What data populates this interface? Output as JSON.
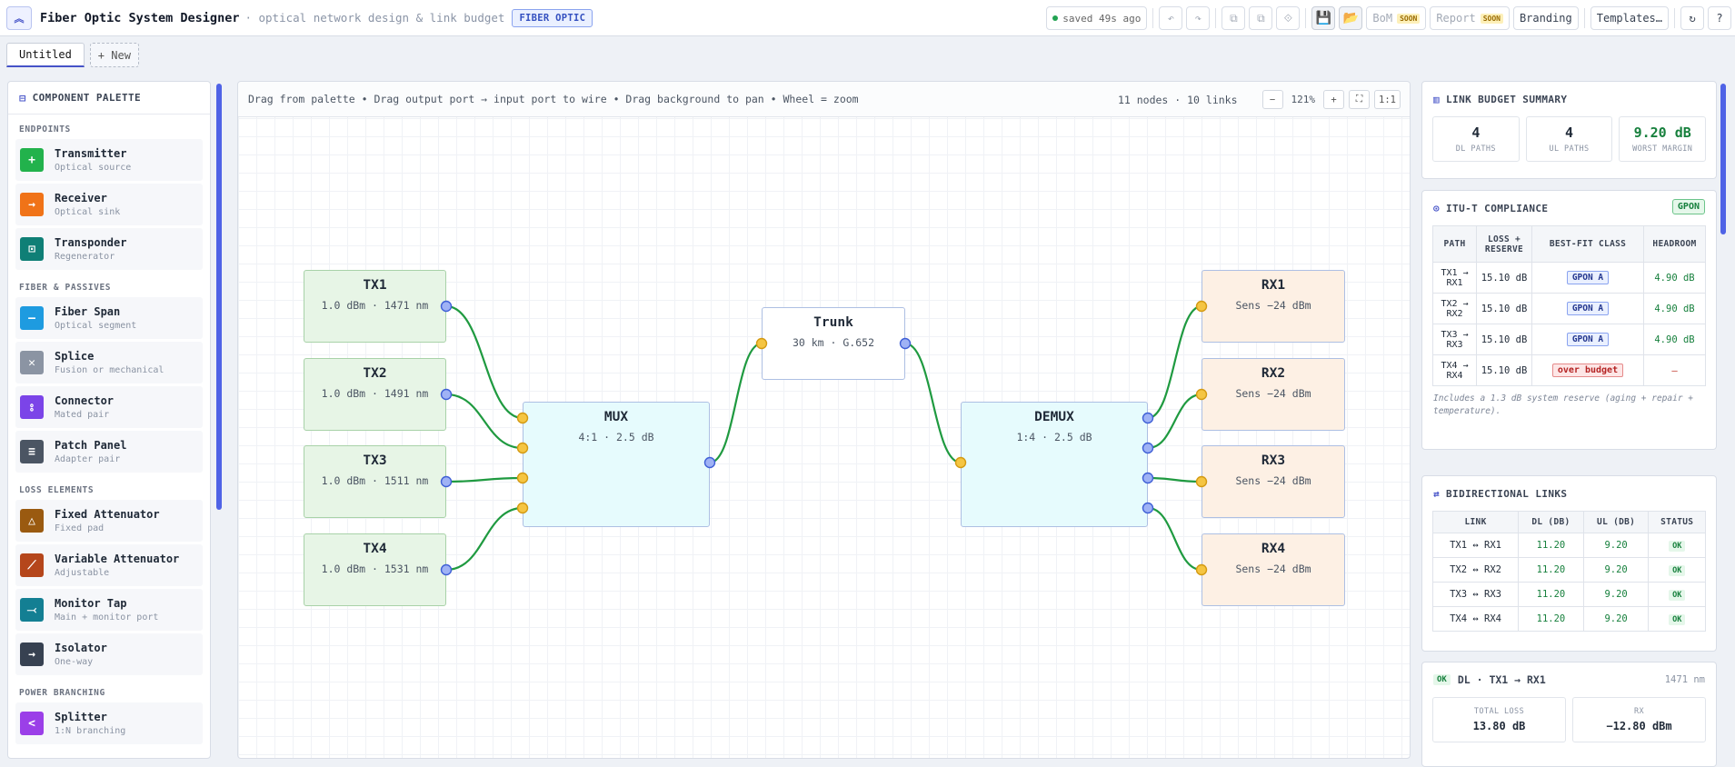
{
  "header": {
    "title": "Fiber Optic System Designer",
    "subtitle": "· optical network design & link budget",
    "badge": "FIBER OPTIC",
    "saved": "saved 49s ago",
    "buttons": {
      "undo": "↶",
      "redo": "↷",
      "copy": "⧉",
      "paste": "⧉",
      "delete": "⟐",
      "save": "💾",
      "open": "📂",
      "bom": "BoM",
      "bom_badge": "SOON",
      "report": "Report",
      "report_badge": "SOON",
      "branding": "Branding",
      "templates": "Templates…",
      "refresh": "↻",
      "help": "?"
    }
  },
  "tabs": [
    {
      "label": "Untitled",
      "active": true
    },
    {
      "label": "+ New",
      "active": false
    }
  ],
  "palette": {
    "title": "COMPONENT PALETTE",
    "sections": [
      {
        "label": "ENDPOINTS",
        "items": [
          {
            "name": "Transmitter",
            "desc": "Optical source",
            "icon": "plus-icon",
            "glyph": "+",
            "color": "#22b24c"
          },
          {
            "name": "Receiver",
            "desc": "Optical sink",
            "icon": "arrow-right-icon",
            "glyph": "→",
            "color": "#f07318"
          },
          {
            "name": "Transponder",
            "desc": "Regenerator",
            "icon": "transponder-icon",
            "glyph": "⊡",
            "color": "#0f7f76"
          }
        ]
      },
      {
        "label": "FIBER & PASSIVES",
        "items": [
          {
            "name": "Fiber Span",
            "desc": "Optical segment",
            "icon": "fiber-span-icon",
            "glyph": "—",
            "color": "#1e9be0"
          },
          {
            "name": "Splice",
            "desc": "Fusion or mechanical",
            "icon": "splice-icon",
            "glyph": "✕",
            "color": "#8b94a3"
          },
          {
            "name": "Connector",
            "desc": "Mated pair",
            "icon": "connector-icon",
            "glyph": "⦂",
            "color": "#7b44e8"
          },
          {
            "name": "Patch Panel",
            "desc": "Adapter pair",
            "icon": "patch-panel-icon",
            "glyph": "≡",
            "color": "#4b5563"
          }
        ]
      },
      {
        "label": "LOSS ELEMENTS",
        "items": [
          {
            "name": "Fixed Attenuator",
            "desc": "Fixed pad",
            "icon": "triangle-icon",
            "glyph": "△",
            "color": "#9a5a10"
          },
          {
            "name": "Variable Attenuator",
            "desc": "Adjustable",
            "icon": "variable-attenuator-icon",
            "glyph": "⟋",
            "color": "#b5461b"
          },
          {
            "name": "Monitor Tap",
            "desc": "Main + monitor port",
            "icon": "tap-icon",
            "glyph": "⤙",
            "color": "#137f93"
          },
          {
            "name": "Isolator",
            "desc": "One-way",
            "icon": "isolator-icon",
            "glyph": "→",
            "color": "#374151"
          }
        ]
      },
      {
        "label": "POWER BRANCHING",
        "items": [
          {
            "name": "Splitter",
            "desc": "1:N branching",
            "icon": "splitter-icon",
            "glyph": "<",
            "color": "#9b3fe8"
          }
        ]
      }
    ]
  },
  "canvas": {
    "hint": "Drag from palette • Drag output port → input port to wire • Drag background to pan • Wheel = zoom",
    "count": "11 nodes · 10 links",
    "zoom": "121%",
    "zoom_out": "−",
    "zoom_in": "+",
    "fit": "⛶",
    "reset": "1:1",
    "nodes": {
      "tx1": {
        "title": "TX1",
        "sub": "1.0 dBm · 1471 nm"
      },
      "tx2": {
        "title": "TX2",
        "sub": "1.0 dBm · 1491 nm"
      },
      "tx3": {
        "title": "TX3",
        "sub": "1.0 dBm · 1511 nm"
      },
      "tx4": {
        "title": "TX4",
        "sub": "1.0 dBm · 1531 nm"
      },
      "mux": {
        "title": "MUX",
        "sub": "4:1 · 2.5 dB"
      },
      "trunk": {
        "title": "Trunk",
        "sub": "30 km · G.652"
      },
      "demux": {
        "title": "DEMUX",
        "sub": "1:4 · 2.5 dB"
      },
      "rx1": {
        "title": "RX1",
        "sub": "Sens −24 dBm"
      },
      "rx2": {
        "title": "RX2",
        "sub": "Sens −24 dBm"
      },
      "rx3": {
        "title": "RX3",
        "sub": "Sens −24 dBm"
      },
      "rx4": {
        "title": "RX4",
        "sub": "Sens −24 dBm"
      }
    }
  },
  "summary": {
    "title": "LINK BUDGET SUMMARY",
    "stats": [
      {
        "value": "4",
        "label": "DL PATHS"
      },
      {
        "value": "4",
        "label": "UL PATHS"
      },
      {
        "value": "9.20 dB",
        "label": "WORST MARGIN"
      }
    ]
  },
  "compliance": {
    "title": "ITU-T COMPLIANCE",
    "badge": "GPON",
    "headers": [
      "PATH",
      "LOSS + RESERVE",
      "BEST-FIT CLASS",
      "HEADROOM"
    ],
    "rows": [
      {
        "path": "TX1 → RX1",
        "loss": "15.10 dB",
        "cls": "GPON A",
        "headroom": "4.90 dB"
      },
      {
        "path": "TX2 → RX2",
        "loss": "15.10 dB",
        "cls": "GPON A",
        "headroom": "4.90 dB"
      },
      {
        "path": "TX3 → RX3",
        "loss": "15.10 dB",
        "cls": "GPON A",
        "headroom": "4.90 dB"
      },
      {
        "path": "TX4 → RX4",
        "loss": "15.10 dB",
        "cls": "over budget",
        "headroom": "—"
      }
    ],
    "note": "Includes a 1.3 dB system reserve (aging + repair + temperature)."
  },
  "bidir": {
    "title": "BIDIRECTIONAL LINKS",
    "headers": [
      "LINK",
      "DL (DB)",
      "UL (DB)",
      "STATUS"
    ],
    "rows": [
      {
        "link": "TX1 ↔ RX1",
        "dl": "11.20",
        "ul": "9.20",
        "status": "OK"
      },
      {
        "link": "TX2 ↔ RX2",
        "dl": "11.20",
        "ul": "9.20",
        "status": "OK"
      },
      {
        "link": "TX3 ↔ RX3",
        "dl": "11.20",
        "ul": "9.20",
        "status": "OK"
      },
      {
        "link": "TX4 ↔ RX4",
        "dl": "11.20",
        "ul": "9.20",
        "status": "OK"
      }
    ]
  },
  "detail": {
    "status": "OK",
    "title": "DL · TX1 → RX1",
    "wavelength": "1471 nm",
    "stats": [
      {
        "label": "TOTAL LOSS",
        "value": "13.80 dB"
      },
      {
        "label": "RX",
        "value": "−12.80 dBm"
      }
    ]
  },
  "colors": {
    "accent": "#4653c8",
    "wire": "#1f9a40",
    "port_in": "#f5c542",
    "port_out": "#9fb2f5"
  }
}
